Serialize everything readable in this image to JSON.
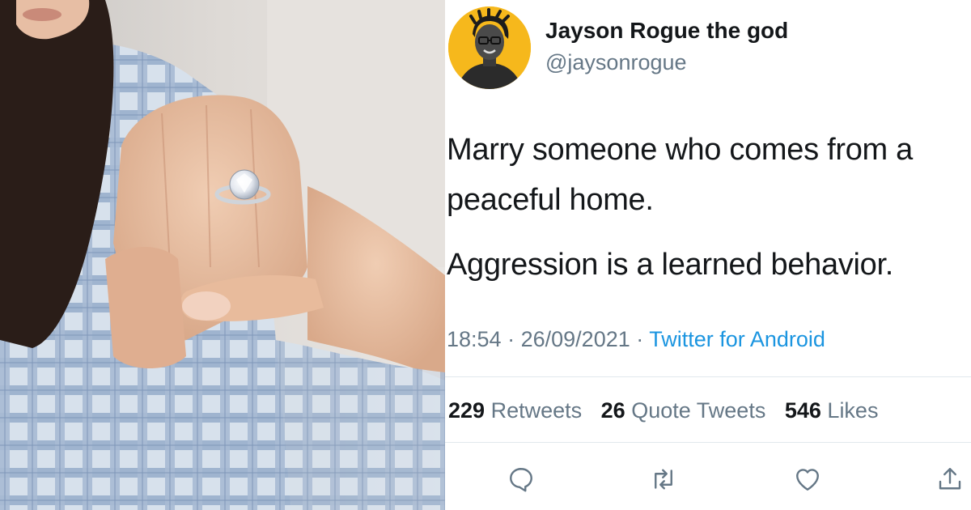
{
  "tweet": {
    "display_name": "Jayson Rogue the god",
    "handle": "@jaysonrogue",
    "text_line1": "Marry someone who comes from a",
    "text_line2": "peaceful home.",
    "text_line3": "Aggression is a learned behavior.",
    "time": "18:54",
    "separator": "·",
    "date": "26/09/2021",
    "source": "Twitter for Android",
    "retweets_count": "229",
    "retweets_label": "Retweets",
    "quotes_count": "26",
    "quotes_label": "Quote Tweets",
    "likes_count": "546",
    "likes_label": "Likes"
  },
  "colors": {
    "text": "#14171a",
    "secondary": "#657786",
    "link": "#1b95e0",
    "divider": "#e1e8ed",
    "avatar_bg": "#f6b81c"
  },
  "icons": [
    "reply-icon",
    "retweet-icon",
    "like-icon",
    "share-icon"
  ]
}
